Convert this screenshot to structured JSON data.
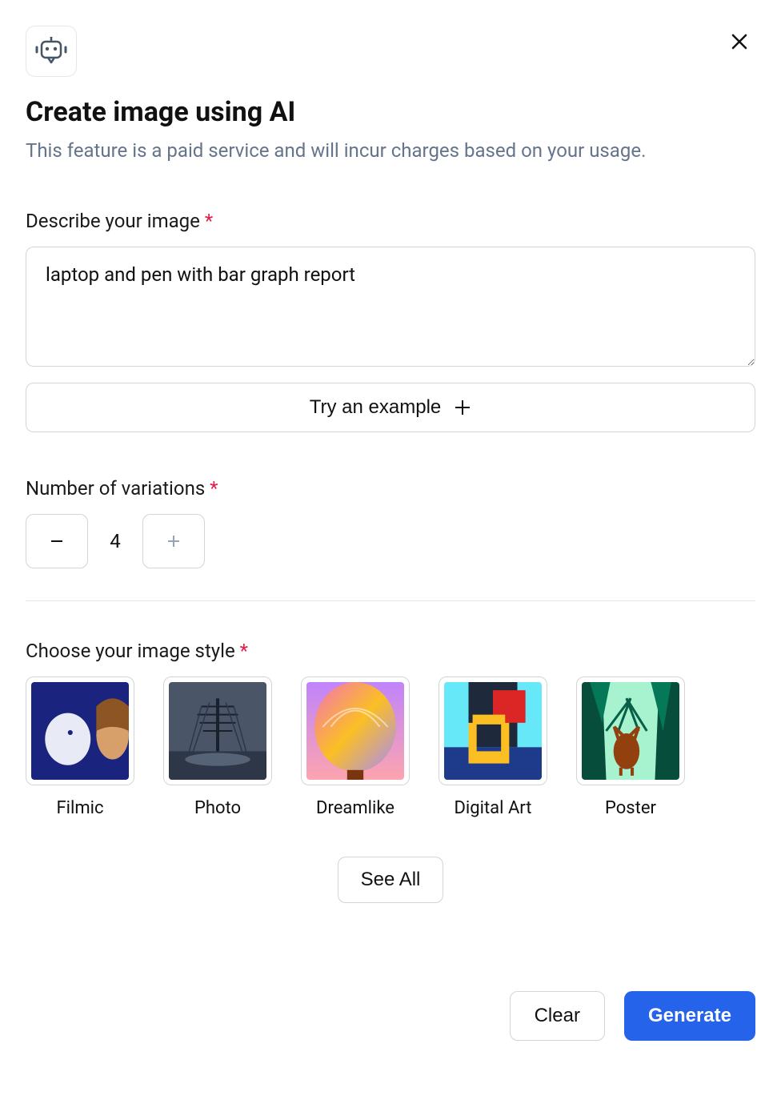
{
  "header": {
    "title": "Create image using AI",
    "subtitle": "This feature is a paid service and will incur charges based on your usage."
  },
  "form": {
    "describe_label": "Describe your image",
    "describe_value": "laptop and pen with bar graph report",
    "try_example_label": "Try an example",
    "variations_label": "Number of variations",
    "variations_value": "4",
    "style_label": "Choose your image style",
    "styles": [
      {
        "label": "Filmic"
      },
      {
        "label": "Photo"
      },
      {
        "label": "Dreamlike"
      },
      {
        "label": "Digital Art"
      },
      {
        "label": "Poster"
      }
    ],
    "see_all_label": "See All"
  },
  "footer": {
    "clear_label": "Clear",
    "generate_label": "Generate"
  }
}
